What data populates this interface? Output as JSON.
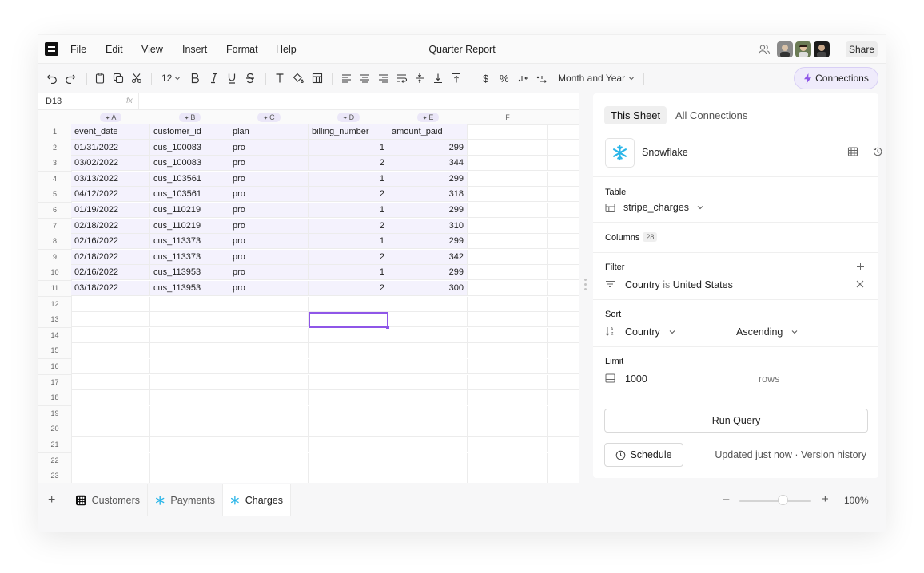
{
  "menu": {
    "items": [
      "File",
      "Edit",
      "View",
      "Insert",
      "Format",
      "Help"
    ],
    "title": "Quarter Report",
    "share_label": "Share"
  },
  "toolbar": {
    "font_size": "12",
    "date_format": "Month and Year",
    "connections_label": "Connections"
  },
  "sheet": {
    "cell_ref": "D13",
    "fx_label": "fx",
    "columns": [
      "A",
      "B",
      "C",
      "D",
      "E",
      "F"
    ],
    "headers": [
      "event_date",
      "customer_id",
      "plan",
      "billing_number",
      "amount_paid"
    ],
    "rows": [
      [
        "01/31/2022",
        "cus_100083",
        "pro",
        "1",
        "299"
      ],
      [
        "03/02/2022",
        "cus_100083",
        "pro",
        "2",
        "344"
      ],
      [
        "03/13/2022",
        "cus_103561",
        "pro",
        "1",
        "299"
      ],
      [
        "04/12/2022",
        "cus_103561",
        "pro",
        "2",
        "318"
      ],
      [
        "01/19/2022",
        "cus_110219",
        "pro",
        "1",
        "299"
      ],
      [
        "02/18/2022",
        "cus_110219",
        "pro",
        "2",
        "310"
      ],
      [
        "02/16/2022",
        "cus_113373",
        "pro",
        "1",
        "299"
      ],
      [
        "02/18/2022",
        "cus_113373",
        "pro",
        "2",
        "342"
      ],
      [
        "02/16/2022",
        "cus_113953",
        "pro",
        "1",
        "299"
      ],
      [
        "03/18/2022",
        "cus_113953",
        "pro",
        "2",
        "300"
      ]
    ],
    "row_numbers": [
      "1",
      "2",
      "3",
      "4",
      "5",
      "6",
      "7",
      "8",
      "9",
      "10",
      "11",
      "12",
      "13",
      "14",
      "15",
      "16",
      "17",
      "18",
      "19",
      "20",
      "21",
      "22",
      "23"
    ]
  },
  "panel": {
    "tabs": [
      "This Sheet",
      "All Connections"
    ],
    "source_name": "Snowflake",
    "table_label": "Table",
    "table_value": "stripe_charges",
    "columns_label": "Columns",
    "columns_count": "28",
    "filter_label": "Filter",
    "filter_field": "Country",
    "filter_op": "is",
    "filter_value": "United States",
    "sort_label": "Sort",
    "sort_field": "Country",
    "sort_order": "Ascending",
    "limit_label": "Limit",
    "limit_value": "1000",
    "limit_unit": "rows",
    "run_label": "Run Query",
    "schedule_label": "Schedule",
    "updated_text": "Updated just now · Version history"
  },
  "tabs": [
    {
      "label": "Customers",
      "icon": "grid-logo-icon"
    },
    {
      "label": "Payments",
      "icon": "snowflake-icon"
    },
    {
      "label": "Charges",
      "icon": "snowflake-icon"
    }
  ],
  "zoom": {
    "minus": "–",
    "plus": "+",
    "value": "100%",
    "level_percent": 60
  },
  "colors": {
    "accent": "#8f56e8",
    "snowflake": "#29b5e8",
    "data_fill": "#f4f2fd"
  }
}
